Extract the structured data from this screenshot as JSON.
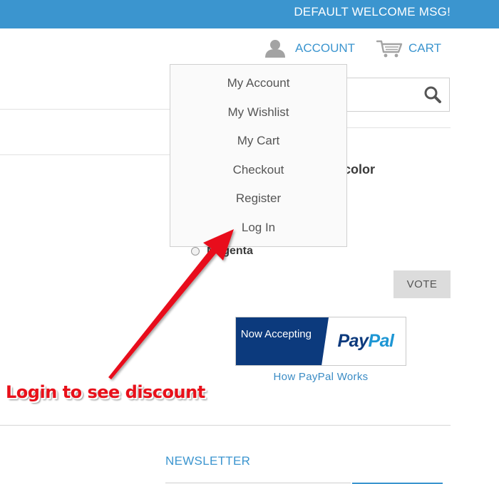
{
  "header": {
    "welcome_message": "DEFAULT WELCOME MSG!",
    "account_label": "ACCOUNT",
    "cart_label": "CART"
  },
  "account_menu": {
    "items": [
      {
        "label": "My Account"
      },
      {
        "label": "My Wishlist"
      },
      {
        "label": "My Cart"
      },
      {
        "label": "Checkout"
      },
      {
        "label": "Register"
      },
      {
        "label": "Log In"
      }
    ]
  },
  "poll": {
    "question_visible_fragment": "color",
    "option_label": "Magenta",
    "vote_label": "VOTE"
  },
  "paypal": {
    "now_accepting": "Now Accepting",
    "logo_pay": "Pay",
    "logo_pal": "Pal",
    "how_it_works_label": "How PayPal Works"
  },
  "annotation": {
    "text": "Login to see discount"
  },
  "footer": {
    "newsletter_title": "NEWSLETTER"
  },
  "icons": {
    "account": "user-icon",
    "cart": "cart-icon",
    "search": "search-icon"
  },
  "colors": {
    "topbar": "#3b95cf",
    "link": "#3b95cf",
    "annotation": "#e8101a",
    "paypal_dark": "#0c3a7d",
    "paypal_light": "#1d96d4"
  }
}
